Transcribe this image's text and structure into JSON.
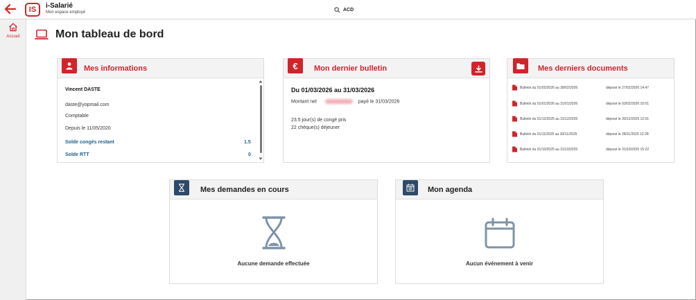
{
  "header": {
    "app_name": "i-Salarié",
    "app_subtitle": "Mon espace employé",
    "logo_text": "IS",
    "search_label": "ACD"
  },
  "sidebar": {
    "items": [
      {
        "label": "Accueil",
        "icon": "home-icon"
      }
    ]
  },
  "page": {
    "title": "Mon tableau de bord"
  },
  "informations": {
    "title": "Mes informations",
    "name": "Vincent DASTE",
    "email": "daste@yopmail.com",
    "role": "Comptable",
    "since": "Depuis le 11/05/2020",
    "conges_label": "Solde congés restant",
    "conges_value": "1.5",
    "rtt_label": "Solde RTT",
    "rtt_value": "0"
  },
  "bulletin": {
    "title": "Mon dernier bulletin",
    "period": "Du 01/03/2026 au 31/03/2026",
    "montant_label": "Montant net",
    "paid": "payé le 31/03/2026",
    "conges": "23.5 jour(s) de congé pris",
    "cheques": "22 chèque(s) déjeuner"
  },
  "documents": {
    "title": "Mes derniers documents",
    "items": [
      {
        "name": "Bulletin du 01/02/2026 au 28/02/2026",
        "deposit": "déposé le  27/02/2026 14:47"
      },
      {
        "name": "Bulletin du 01/01/2026 au 31/01/2026",
        "deposit": "déposé le  03/02/2026 10:01"
      },
      {
        "name": "Bulletin du 01/12/2025 au 31/12/2025",
        "deposit": "déposé le  30/12/2025 12:01"
      },
      {
        "name": "Bulletin du 01/11/2025 au 30/11/2025",
        "deposit": "déposé le  28/11/2025 12:28"
      },
      {
        "name": "Bulletin du 01/10/2025 au 31/10/2025",
        "deposit": "déposé le  31/10/2025 15:22"
      }
    ]
  },
  "demandes": {
    "title": "Mes demandes en cours",
    "empty": "Aucune demande effectuée"
  },
  "agenda": {
    "title": "Mon agenda",
    "empty": "Aucun événement à venir"
  },
  "colors": {
    "brand": "#d2232a",
    "navy": "#2e4a6a",
    "link": "#1f5f8b"
  }
}
